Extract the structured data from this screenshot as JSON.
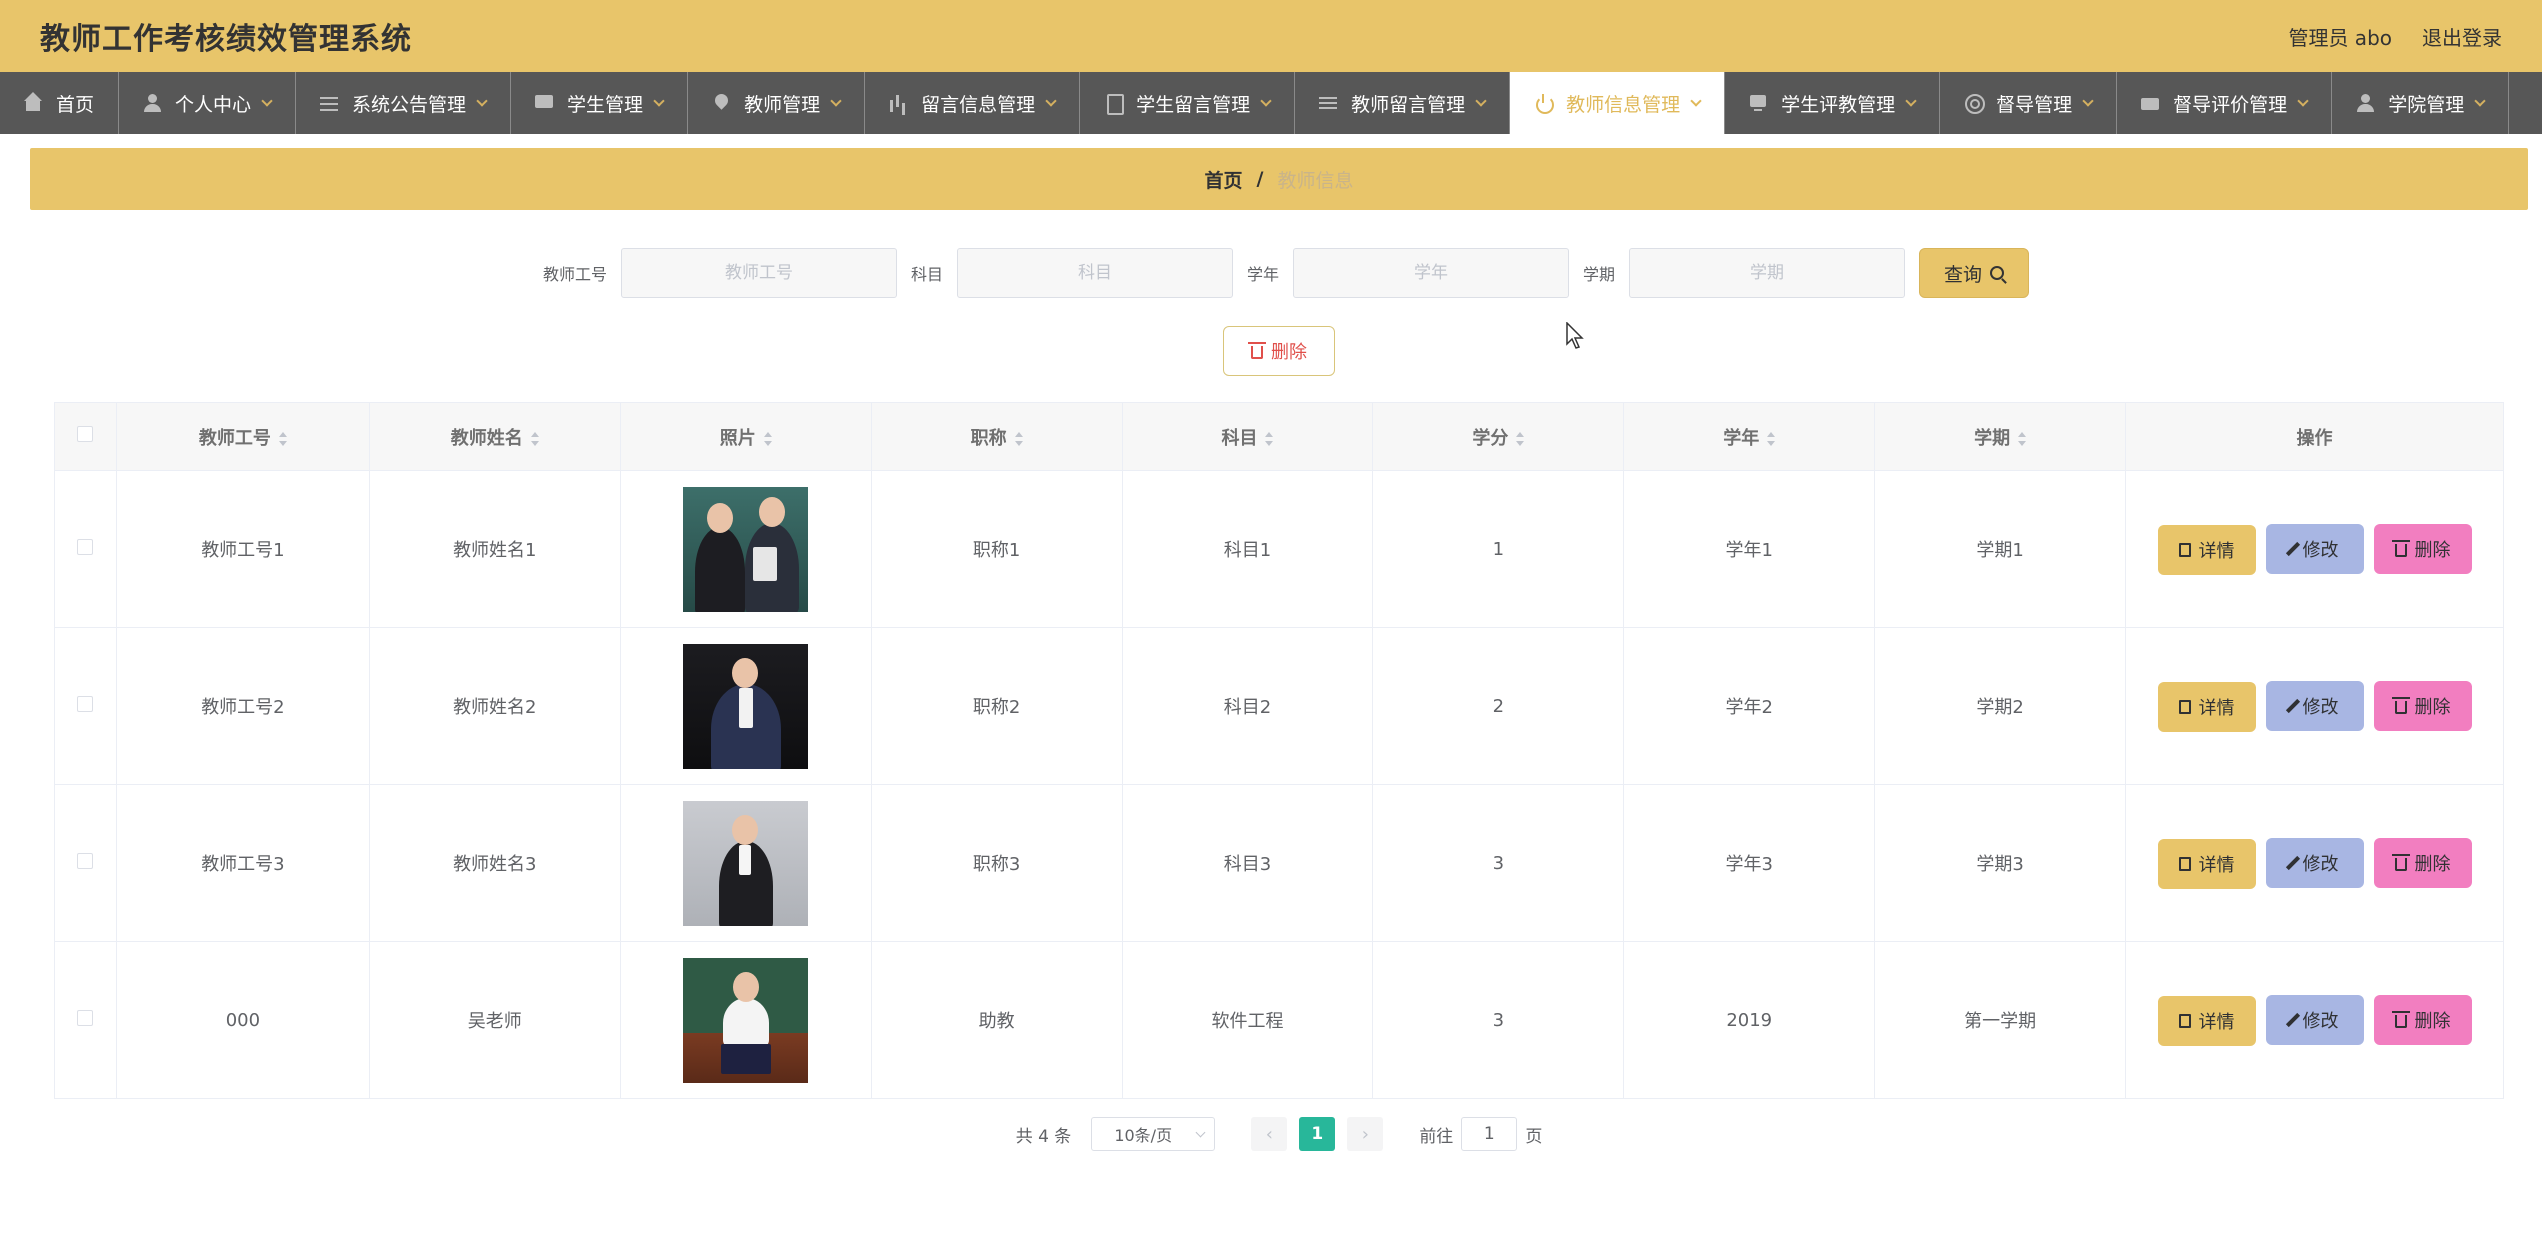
{
  "app": {
    "title": "教师工作考核绩效管理系统"
  },
  "header": {
    "user_label": "管理员 abo",
    "logout_label": "退出登录"
  },
  "nav": {
    "items": [
      {
        "label": "首页",
        "icon": "home-icon"
      },
      {
        "label": "个人中心",
        "icon": "user-icon"
      },
      {
        "label": "系统公告管理",
        "icon": "sliders-icon"
      },
      {
        "label": "学生管理",
        "icon": "chat-icon"
      },
      {
        "label": "教师管理",
        "icon": "map-pin-icon"
      },
      {
        "label": "留言信息管理",
        "icon": "bar-chart-icon"
      },
      {
        "label": "学生留言管理",
        "icon": "document-icon"
      },
      {
        "label": "教师留言管理",
        "icon": "list-icon"
      },
      {
        "label": "教师信息管理",
        "icon": "power-icon"
      },
      {
        "label": "学生评教管理",
        "icon": "monitor-icon"
      },
      {
        "label": "督导管理",
        "icon": "ring-icon"
      },
      {
        "label": "督导评价管理",
        "icon": "wallet-icon"
      },
      {
        "label": "学院管理",
        "icon": "user-icon"
      }
    ],
    "active_index": 8,
    "active_color": "#e0b95a"
  },
  "breadcrumb": {
    "home": "首页",
    "separator": "/",
    "current": "教师信息"
  },
  "search": {
    "fields": [
      {
        "label": "教师工号",
        "placeholder": "教师工号"
      },
      {
        "label": "科目",
        "placeholder": "科目"
      },
      {
        "label": "学年",
        "placeholder": "学年"
      },
      {
        "label": "学期",
        "placeholder": "学期"
      }
    ],
    "button_label": "查询"
  },
  "toolbar": {
    "delete_label": "删除"
  },
  "table": {
    "columns": [
      "教师工号",
      "教师姓名",
      "照片",
      "职称",
      "科目",
      "学分",
      "学年",
      "学期",
      "操作"
    ],
    "rows": [
      {
        "id": "教师工号1",
        "name": "教师姓名1",
        "title": "职称1",
        "subject": "科目1",
        "credit": "1",
        "year": "学年1",
        "term": "学期1"
      },
      {
        "id": "教师工号2",
        "name": "教师姓名2",
        "title": "职称2",
        "subject": "科目2",
        "credit": "2",
        "year": "学年2",
        "term": "学期2"
      },
      {
        "id": "教师工号3",
        "name": "教师姓名3",
        "title": "职称3",
        "subject": "科目3",
        "credit": "3",
        "year": "学年3",
        "term": "学期3"
      },
      {
        "id": "000",
        "name": "吴老师",
        "title": "助教",
        "subject": "软件工程",
        "credit": "3",
        "year": "2019",
        "term": "第一学期"
      }
    ],
    "actions": {
      "detail": "详情",
      "edit": "修改",
      "delete": "删除"
    }
  },
  "pagination": {
    "total_label": "共 4 条",
    "page_size_label": "10条/页",
    "current_page": "1",
    "goto_label": "前往",
    "goto_value": "1",
    "page_suffix": "页"
  },
  "colors": {
    "header": "#e8c56a",
    "nav": "#575757",
    "pager_active": "#28b79a",
    "edit": "#a8b6e3",
    "delete": "#f27ec0"
  }
}
